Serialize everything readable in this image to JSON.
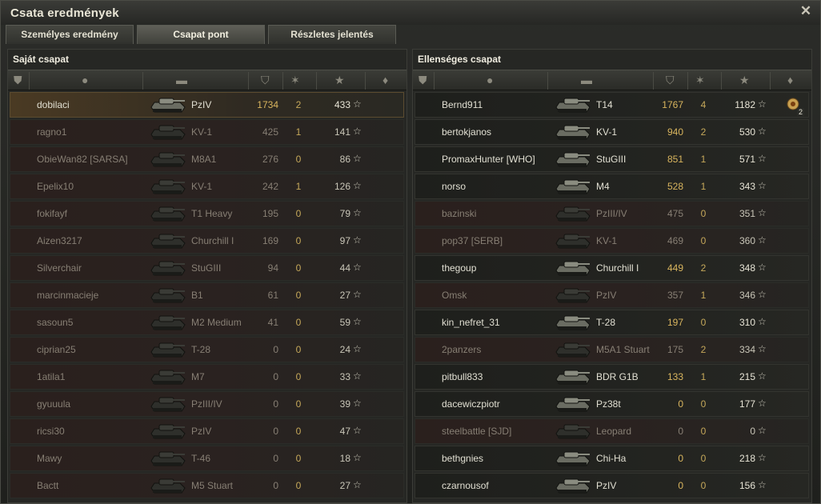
{
  "window": {
    "title": "Csata eredmények"
  },
  "tabs": [
    {
      "label": "Személyes eredmény",
      "active": false
    },
    {
      "label": "Csapat pont",
      "active": true
    },
    {
      "label": "Részletes jelentés",
      "active": false
    }
  ],
  "columns": {
    "icons": [
      "flag-icon",
      "player-icon",
      "tank-icon",
      "damage-icon",
      "kills-icon",
      "experience-star-icon",
      "medal-icon"
    ]
  },
  "own_team": {
    "title": "Saját csapat",
    "rows": [
      {
        "player": "dobilaci",
        "tank": "PzIV",
        "damage": "1734",
        "kills": "2",
        "xp": "433",
        "state": "me"
      },
      {
        "player": "ragno1",
        "tank": "KV-1",
        "damage": "425",
        "kills": "1",
        "xp": "141",
        "state": "dead"
      },
      {
        "player": "ObieWan82 [SARSA]",
        "tank": "M8A1",
        "damage": "276",
        "kills": "0",
        "xp": "86",
        "state": "dead"
      },
      {
        "player": "Epelix10",
        "tank": "KV-1",
        "damage": "242",
        "kills": "1",
        "xp": "126",
        "state": "dead"
      },
      {
        "player": "fokifayf",
        "tank": "T1 Heavy",
        "damage": "195",
        "kills": "0",
        "xp": "79",
        "state": "dead"
      },
      {
        "player": "Aizen3217",
        "tank": "Churchill I",
        "damage": "169",
        "kills": "0",
        "xp": "97",
        "state": "dead"
      },
      {
        "player": "Silverchair",
        "tank": "StuGIII",
        "damage": "94",
        "kills": "0",
        "xp": "44",
        "state": "dead"
      },
      {
        "player": "marcinmacieje",
        "tank": "B1",
        "damage": "61",
        "kills": "0",
        "xp": "27",
        "state": "dead"
      },
      {
        "player": "sasoun5",
        "tank": "M2 Medium",
        "damage": "41",
        "kills": "0",
        "xp": "59",
        "state": "dead"
      },
      {
        "player": "ciprian25",
        "tank": "T-28",
        "damage": "0",
        "kills": "0",
        "xp": "24",
        "state": "dead"
      },
      {
        "player": "1atila1",
        "tank": "M7",
        "damage": "0",
        "kills": "0",
        "xp": "33",
        "state": "dead"
      },
      {
        "player": "gyuuula",
        "tank": "PzIII/IV",
        "damage": "0",
        "kills": "0",
        "xp": "39",
        "state": "dead"
      },
      {
        "player": "ricsi30",
        "tank": "PzIV",
        "damage": "0",
        "kills": "0",
        "xp": "47",
        "state": "dead"
      },
      {
        "player": "Mawy",
        "tank": "T-46",
        "damage": "0",
        "kills": "0",
        "xp": "18",
        "state": "dead"
      },
      {
        "player": "Bactt",
        "tank": "M5 Stuart",
        "damage": "0",
        "kills": "0",
        "xp": "27",
        "state": "dead"
      }
    ]
  },
  "enemy_team": {
    "title": "Ellenséges csapat",
    "rows": [
      {
        "player": "Bernd911",
        "tank": "T14",
        "damage": "1767",
        "kills": "4",
        "xp": "1182",
        "state": "alive",
        "medal": "2"
      },
      {
        "player": "bertokjanos",
        "tank": "KV-1",
        "damage": "940",
        "kills": "2",
        "xp": "530",
        "state": "alive"
      },
      {
        "player": "PromaxHunter [WHO]",
        "tank": "StuGIII",
        "damage": "851",
        "kills": "1",
        "xp": "571",
        "state": "alive"
      },
      {
        "player": "norso",
        "tank": "M4",
        "damage": "528",
        "kills": "1",
        "xp": "343",
        "state": "alive"
      },
      {
        "player": "bazinski",
        "tank": "PzIII/IV",
        "damage": "475",
        "kills": "0",
        "xp": "351",
        "state": "dead"
      },
      {
        "player": "pop37 [SERB]",
        "tank": "KV-1",
        "damage": "469",
        "kills": "0",
        "xp": "360",
        "state": "dead"
      },
      {
        "player": "thegoup",
        "tank": "Churchill I",
        "damage": "449",
        "kills": "2",
        "xp": "348",
        "state": "alive"
      },
      {
        "player": "Omsk",
        "tank": "PzIV",
        "damage": "357",
        "kills": "1",
        "xp": "346",
        "state": "dead"
      },
      {
        "player": "kin_nefret_31",
        "tank": "T-28",
        "damage": "197",
        "kills": "0",
        "xp": "310",
        "state": "alive"
      },
      {
        "player": "2panzers",
        "tank": "M5A1 Stuart",
        "damage": "175",
        "kills": "2",
        "xp": "334",
        "state": "dead"
      },
      {
        "player": "pitbull833",
        "tank": "BDR G1B",
        "damage": "133",
        "kills": "1",
        "xp": "215",
        "state": "alive"
      },
      {
        "player": "dacewiczpiotr",
        "tank": "Pz38t",
        "damage": "0",
        "kills": "0",
        "xp": "177",
        "state": "alive"
      },
      {
        "player": "steelbattle [SJD]",
        "tank": "Leopard",
        "damage": "0",
        "kills": "0",
        "xp": "0",
        "state": "dead"
      },
      {
        "player": "bethgnies",
        "tank": "Chi-Ha",
        "damage": "0",
        "kills": "0",
        "xp": "218",
        "state": "alive"
      },
      {
        "player": "czarnousof",
        "tank": "PzIV",
        "damage": "0",
        "kills": "0",
        "xp": "156",
        "state": "alive"
      }
    ]
  },
  "colors": {
    "damage_alive": "#d9b55e",
    "dead_text": "#877f74",
    "alive_text": "#e1dfd2"
  }
}
